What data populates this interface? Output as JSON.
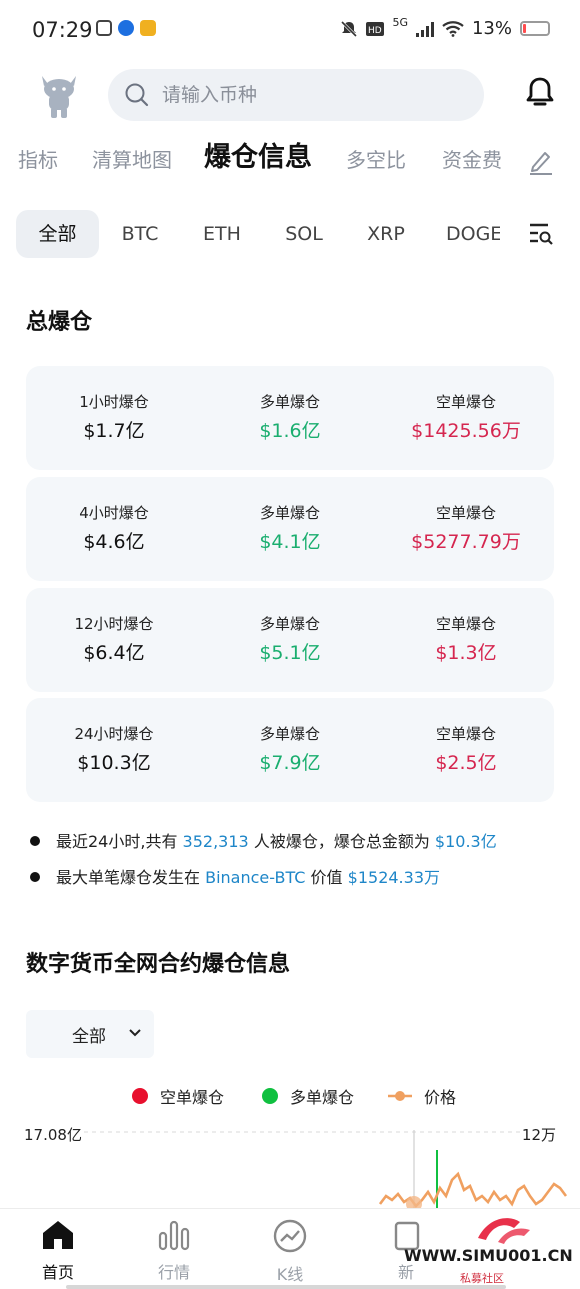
{
  "status_bar": {
    "time": "07:29",
    "network": "5G",
    "battery": "13%",
    "battery_level": 0.13
  },
  "header": {
    "search_placeholder": "请输入币种"
  },
  "category_tabs": [
    {
      "label": "指标",
      "active": false
    },
    {
      "label": "清算地图",
      "active": false
    },
    {
      "label": "爆仓信息",
      "active": true
    },
    {
      "label": "多空比",
      "active": false
    },
    {
      "label": "资金费",
      "active": false
    }
  ],
  "coin_tabs": [
    {
      "label": "全部",
      "active": true
    },
    {
      "label": "BTC",
      "active": false
    },
    {
      "label": "ETH",
      "active": false
    },
    {
      "label": "SOL",
      "active": false
    },
    {
      "label": "XRP",
      "active": false
    },
    {
      "label": "DOGE",
      "active": false
    }
  ],
  "total_section": {
    "title": "总爆仓",
    "cards": [
      {
        "period_label": "1小时爆仓",
        "period_value": "$1.7亿",
        "long_label": "多单爆仓",
        "long_value": "$1.6亿",
        "short_label": "空单爆仓",
        "short_value": "$1425.56万"
      },
      {
        "period_label": "4小时爆仓",
        "period_value": "$4.6亿",
        "long_label": "多单爆仓",
        "long_value": "$4.1亿",
        "short_label": "空单爆仓",
        "short_value": "$5277.79万"
      },
      {
        "period_label": "12小时爆仓",
        "period_value": "$6.4亿",
        "long_label": "多单爆仓",
        "long_value": "$5.1亿",
        "short_label": "空单爆仓",
        "short_value": "$1.3亿"
      },
      {
        "period_label": "24小时爆仓",
        "period_value": "$10.3亿",
        "long_label": "多单爆仓",
        "long_value": "$7.9亿",
        "short_label": "空单爆仓",
        "short_value": "$2.5亿"
      }
    ]
  },
  "summary": {
    "line1_prefix": "最近24小时,共有",
    "line1_people": "352,313",
    "line1_mid": "人被爆仓，爆仓总金额为",
    "line1_amount": "$10.3亿",
    "line2_prefix": "最大单笔爆仓发生在",
    "line2_exchange": "Binance-BTC",
    "line2_mid": "价值",
    "line2_amount": "$1524.33万"
  },
  "chart_section": {
    "title": "数字货币全网合约爆仓信息",
    "dropdown_value": "全部",
    "legend": [
      {
        "label": "空单爆仓",
        "color": "#e8102e"
      },
      {
        "label": "多单爆仓",
        "color": "#10c040"
      },
      {
        "label": "价格",
        "color": "#f0a060"
      }
    ],
    "axis_left_top": "17.08亿",
    "axis_right_top": "12万"
  },
  "bottom_nav": [
    {
      "label": "首页",
      "icon": "home-icon",
      "active": true
    },
    {
      "label": "行情",
      "icon": "bars-chart-icon",
      "active": false
    },
    {
      "label": "K线",
      "icon": "trend-circle-icon",
      "active": false
    },
    {
      "label": "新",
      "icon": "news-icon",
      "active": false
    }
  ],
  "watermark": {
    "text": "WWW.SIMU001.CN",
    "subtext": "私募社区"
  },
  "colors": {
    "long": "#1aae6f",
    "short": "#d5264f",
    "link": "#1e86c8"
  }
}
